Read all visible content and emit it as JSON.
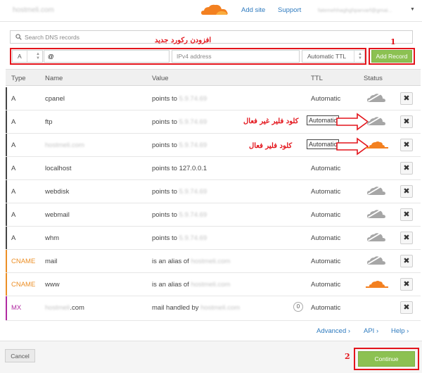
{
  "header": {
    "site_name": "hostmeli.com",
    "nav": [
      "Add site",
      "Support"
    ],
    "user_email": "fatemehhaghghparvarf@gmai..."
  },
  "search": {
    "placeholder": "Search DNS records"
  },
  "add_record": {
    "type": "A",
    "name_value": "@",
    "value_placeholder": "IPv4 address",
    "ttl": "Automatic TTL",
    "button": "Add Record"
  },
  "annotations": {
    "add_record_title": "افزودن رکورد جدید",
    "step1": "1",
    "step2": "2",
    "cloudflare_inactive": "کلود فلیر غیر فعال",
    "cloudflare_active": "کلود فلیر فعال"
  },
  "table": {
    "columns": [
      "Type",
      "Name",
      "Value",
      "TTL",
      "Status"
    ],
    "rows": [
      {
        "type": "A",
        "name": "cpanel",
        "value_prefix": "points to ",
        "value_masked": "5.9.74.69",
        "ttl": "Automatic",
        "proxy": "off"
      },
      {
        "type": "A",
        "name": "ftp",
        "value_prefix": "points to ",
        "value_masked": "5.9.74.69",
        "ttl": "Automatic",
        "proxy": "off"
      },
      {
        "type": "A",
        "name": "hostmeli.com",
        "value_prefix": "points to ",
        "value_masked": "5.9.74.69",
        "ttl": "Automatic",
        "proxy": "on"
      },
      {
        "type": "A",
        "name": "localhost",
        "value_prefix": "points to ",
        "value_masked": "127.0.0.1",
        "ttl": "Automatic",
        "proxy": "none"
      },
      {
        "type": "A",
        "name": "webdisk",
        "value_prefix": "points to ",
        "value_masked": "5.9.74.69",
        "ttl": "Automatic",
        "proxy": "off"
      },
      {
        "type": "A",
        "name": "webmail",
        "value_prefix": "points to ",
        "value_masked": "5.9.74.69",
        "ttl": "Automatic",
        "proxy": "off"
      },
      {
        "type": "A",
        "name": "whm",
        "value_prefix": "points to ",
        "value_masked": "5.9.74.69",
        "ttl": "Automatic",
        "proxy": "off"
      },
      {
        "type": "CNAME",
        "name": "mail",
        "value_prefix": "is an alias of ",
        "value_masked": "hostmeli.com",
        "ttl": "Automatic",
        "proxy": "off"
      },
      {
        "type": "CNAME",
        "name": "www",
        "value_prefix": "is an alias of ",
        "value_masked": "hostmeli.com",
        "ttl": "Automatic",
        "proxy": "on"
      },
      {
        "type": "MX",
        "name": "hostmeli.com",
        "value_prefix": "mail handled by ",
        "value_masked": "hostmeli.com",
        "priority": "0",
        "ttl": "Automatic",
        "proxy": "none"
      }
    ]
  },
  "footer": {
    "links": [
      "Advanced ›",
      "API ›",
      "Help ›"
    ],
    "cancel": "Cancel",
    "continue": "Continue"
  },
  "colors": {
    "accent_green": "#8cc152",
    "cloud_orange": "#f38020",
    "cloud_gray": "#a6a6a6",
    "annotation_red": "#e3141b",
    "link_blue": "#2f7bbf",
    "type_a": "#333333",
    "type_cname": "#ec8f26",
    "type_mx": "#b12ba2"
  },
  "icons": {
    "search": "search-icon",
    "proxy_off": "cloud-gray-icon",
    "proxy_on": "cloud-orange-icon",
    "delete": "close-icon"
  }
}
